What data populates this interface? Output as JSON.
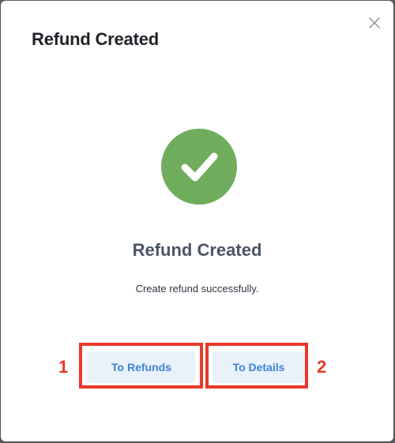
{
  "modal": {
    "title": "Refund Created"
  },
  "result": {
    "icon": "check-circle-icon",
    "icon_color": "#6fad5d",
    "headline": "Refund Created",
    "message": "Create refund successfully."
  },
  "actions": {
    "to_refunds_label": "To Refunds",
    "to_details_label": "To Details",
    "button_text_color": "#3f84d4",
    "button_bg_color": "#e9f1fb"
  },
  "annotations": {
    "marker_1": "1",
    "marker_2": "2",
    "highlight_color": "#e8392b"
  }
}
